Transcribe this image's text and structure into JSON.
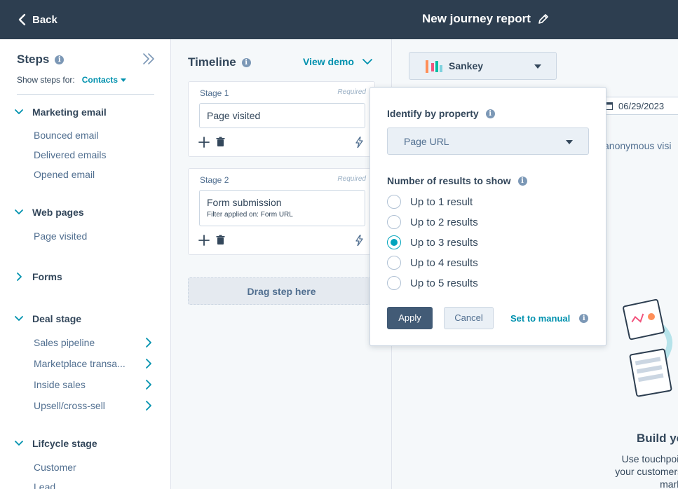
{
  "topbar": {
    "back_label": "Back",
    "title": "New journey report"
  },
  "steps": {
    "title": "Steps",
    "show_for_label": "Show steps for:",
    "show_for_value": "Contacts",
    "groups": [
      {
        "label": "Marketing email",
        "items": [
          "Bounced email",
          "Delivered emails",
          "Opened email"
        ]
      },
      {
        "label": "Web pages",
        "items": [
          "Page visited"
        ]
      },
      {
        "label": "Forms",
        "items": []
      },
      {
        "label": "Deal stage",
        "items": [
          "Sales pipeline",
          "Marketplace transa...",
          "Inside sales",
          "Upsell/cross-sell"
        ]
      },
      {
        "label": "Lifcycle stage",
        "items": [
          "Customer",
          "Lead"
        ]
      }
    ]
  },
  "timeline": {
    "title": "Timeline",
    "view_demo": "View demo",
    "stages": [
      {
        "label": "Stage 1",
        "required": "Required",
        "step": "Page visited",
        "filter": ""
      },
      {
        "label": "Stage 2",
        "required": "Required",
        "step": "Form submission",
        "filter": "Filter applied on: Form URL"
      }
    ],
    "drop_label": "Drag step here"
  },
  "canvas": {
    "chart_type": "Sankey",
    "date": "06/29/2023",
    "anonymous_text": "anonymous visi",
    "build_title": "Build yo",
    "build_text": [
      "Use touchpoints",
      "your customers w",
      "marketi"
    ]
  },
  "popover": {
    "identify_label": "Identify by property",
    "property_value": "Page URL",
    "results_label": "Number of results to show",
    "options": [
      "Up to 1 result",
      "Up to 2 results",
      "Up to 3 results",
      "Up to 4 results",
      "Up to 5 results"
    ],
    "selected_index": 2,
    "apply_label": "Apply",
    "cancel_label": "Cancel",
    "set_manual_label": "Set to manual"
  },
  "colors": {
    "topbar": "#2d3e50",
    "accent": "#0091ae",
    "radio_selected": "#00a4bd",
    "apply_button": "#425b76"
  }
}
